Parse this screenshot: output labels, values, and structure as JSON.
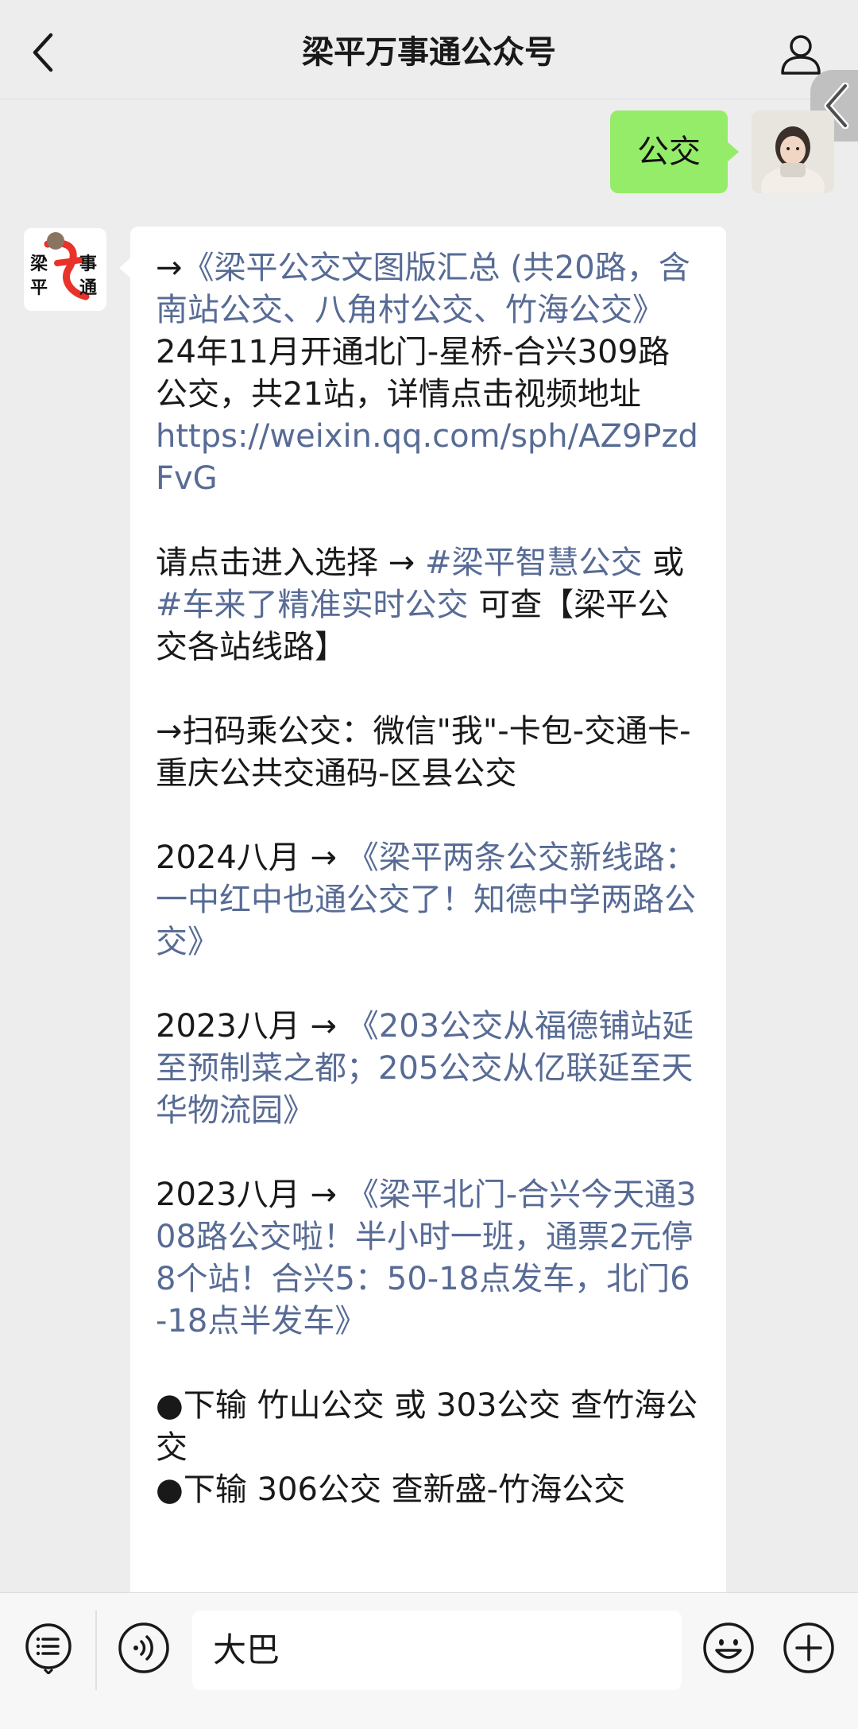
{
  "header": {
    "title": "梁平万事通公众号"
  },
  "chat": {
    "my_message": "公交",
    "oa_logo": {
      "char1": "梁",
      "char2": "事",
      "char3": "平",
      "char4": "通"
    },
    "reply": {
      "l1_arrow": "→",
      "l1_link": "《梁平公交文图版汇总 (共20路，含南站公交、八角村公交、竹海公交》",
      "l2_text": "24年11月开通北门-星桥-合兴309路公交，共21站，详情点击视频地址",
      "l2_link": "https://weixin.qq.com/sph/AZ9PzdFvG",
      "l3_text1": "请点击进入选择 → ",
      "l3_link1": "#梁平智慧公交",
      "l3_text2": " 或 ",
      "l3_link2": "#车来了精准实时公交",
      "l3_text3": " 可查【梁平公交各站线路】",
      "l4_text": "→扫码乘公交：微信\"我\"-卡包-交通卡-重庆公共交通码-区县公交",
      "l5_text": "2024八月 → ",
      "l5_link": "《梁平两条公交新线路：一中红中也通公交了！知德中学两路公交》",
      "l6_text": "2023八月 → ",
      "l6_link": "《203公交从福德铺站延至预制菜之都；205公交从亿联延至天华物流园》",
      "l7_text": "2023八月 → ",
      "l7_link": "《梁平北门-合兴今天通308路公交啦！半小时一班，通票2元停8个站！合兴5：50-18点发车，北门6-18点半发车》",
      "l8_text": "●下输 竹山公交 或 303公交 查竹海公交",
      "l9_text": "●下输 306公交 查新盛-竹海公交"
    }
  },
  "input": {
    "value": "大巴"
  },
  "colors": {
    "my_bubble": "#95ec69",
    "link": "#576b95",
    "background": "#ededed"
  }
}
